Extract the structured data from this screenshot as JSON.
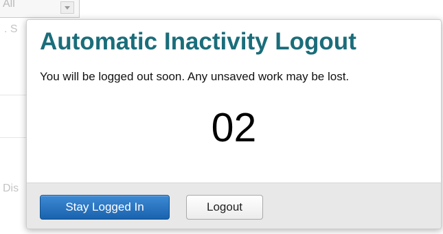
{
  "background": {
    "filter_select_value": "All",
    "label_fragment_top": ". S",
    "label_fragment_bottom": "Dis"
  },
  "dialog": {
    "title": "Automatic Inactivity Logout",
    "message": "You will be logged out soon. Any unsaved work may be lost.",
    "countdown": "02",
    "buttons": {
      "stay": "Stay Logged In",
      "logout": "Logout"
    }
  },
  "colors": {
    "title": "#1b6d7a",
    "primary_button": "#1a62ad",
    "footer_background": "#e8e8e8"
  }
}
